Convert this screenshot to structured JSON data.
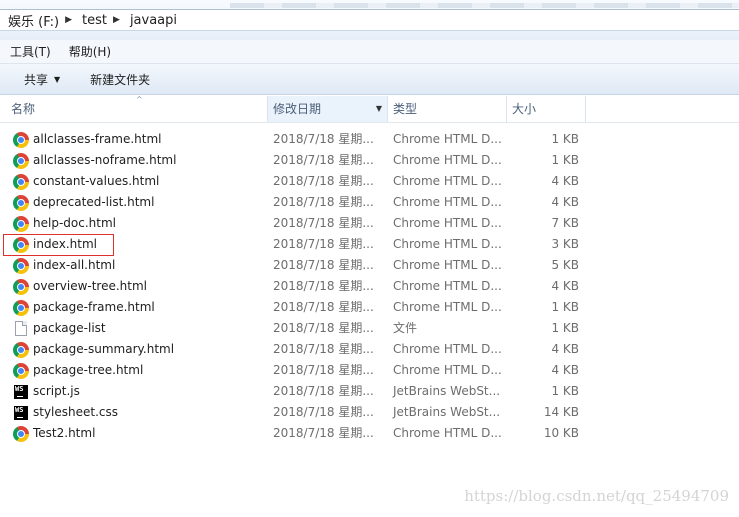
{
  "breadcrumb": [
    "娱乐 (F:)",
    "test",
    "javaapi"
  ],
  "menu": {
    "tools": "工具(T)",
    "help": "帮助(H)"
  },
  "toolbar": {
    "share": "共享",
    "new_folder": "新建文件夹"
  },
  "columns": {
    "name": "名称",
    "date": "修改日期",
    "type": "类型",
    "size": "大小"
  },
  "files": [
    {
      "name": "allclasses-frame.html",
      "date": "2018/7/18 星期...",
      "type": "Chrome HTML D...",
      "size": "1 KB",
      "icon": "chrome-icon"
    },
    {
      "name": "allclasses-noframe.html",
      "date": "2018/7/18 星期...",
      "type": "Chrome HTML D...",
      "size": "1 KB",
      "icon": "chrome-icon"
    },
    {
      "name": "constant-values.html",
      "date": "2018/7/18 星期...",
      "type": "Chrome HTML D...",
      "size": "4 KB",
      "icon": "chrome-icon"
    },
    {
      "name": "deprecated-list.html",
      "date": "2018/7/18 星期...",
      "type": "Chrome HTML D...",
      "size": "4 KB",
      "icon": "chrome-icon"
    },
    {
      "name": "help-doc.html",
      "date": "2018/7/18 星期...",
      "type": "Chrome HTML D...",
      "size": "7 KB",
      "icon": "chrome-icon"
    },
    {
      "name": "index.html",
      "date": "2018/7/18 星期...",
      "type": "Chrome HTML D...",
      "size": "3 KB",
      "icon": "chrome-icon",
      "highlighted": true
    },
    {
      "name": "index-all.html",
      "date": "2018/7/18 星期...",
      "type": "Chrome HTML D...",
      "size": "5 KB",
      "icon": "chrome-icon"
    },
    {
      "name": "overview-tree.html",
      "date": "2018/7/18 星期...",
      "type": "Chrome HTML D...",
      "size": "4 KB",
      "icon": "chrome-icon"
    },
    {
      "name": "package-frame.html",
      "date": "2018/7/18 星期...",
      "type": "Chrome HTML D...",
      "size": "1 KB",
      "icon": "chrome-icon"
    },
    {
      "name": "package-list",
      "date": "2018/7/18 星期...",
      "type": "文件",
      "size": "1 KB",
      "icon": "file-icon"
    },
    {
      "name": "package-summary.html",
      "date": "2018/7/18 星期...",
      "type": "Chrome HTML D...",
      "size": "4 KB",
      "icon": "chrome-icon"
    },
    {
      "name": "package-tree.html",
      "date": "2018/7/18 星期...",
      "type": "Chrome HTML D...",
      "size": "4 KB",
      "icon": "chrome-icon"
    },
    {
      "name": "script.js",
      "date": "2018/7/18 星期...",
      "type": "JetBrains WebSt...",
      "size": "1 KB",
      "icon": "webstorm-icon"
    },
    {
      "name": "stylesheet.css",
      "date": "2018/7/18 星期...",
      "type": "JetBrains WebSt...",
      "size": "14 KB",
      "icon": "webstorm-icon"
    },
    {
      "name": "Test2.html",
      "date": "2018/7/18 星期...",
      "type": "Chrome HTML D...",
      "size": "10 KB",
      "icon": "chrome-icon"
    }
  ],
  "watermark": "https://blog.csdn.net/qq_25494709",
  "colors": {
    "highlight_border": "#e0302c"
  }
}
